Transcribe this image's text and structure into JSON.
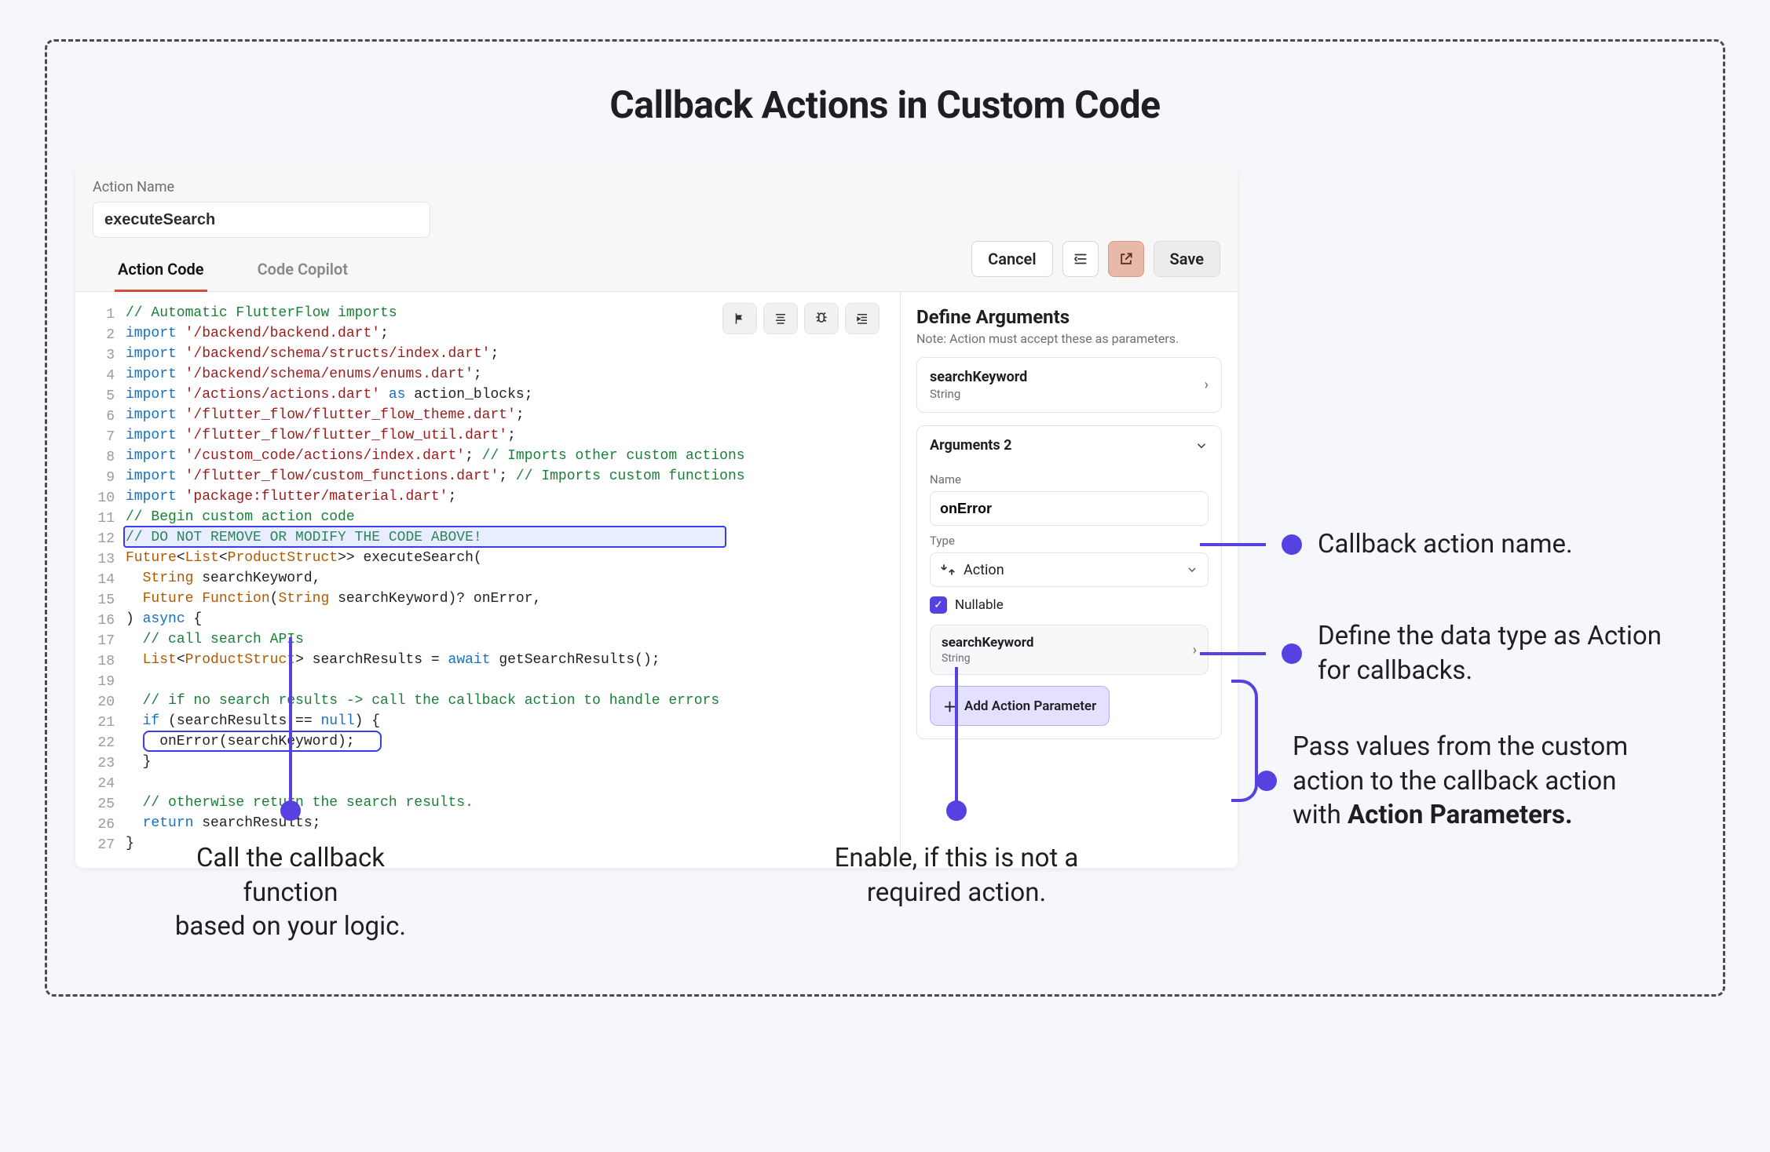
{
  "title": "Callback Actions in Custom Code",
  "toolbar": {
    "label": "Action Name",
    "action_name": "executeSearch",
    "cancel": "Cancel",
    "save": "Save"
  },
  "tabs": {
    "code": "Action Code",
    "copilot": "Code Copilot"
  },
  "code": {
    "lines": [
      {
        "n": 1,
        "seg": [
          [
            "com",
            "// Automatic FlutterFlow imports"
          ]
        ]
      },
      {
        "n": 2,
        "seg": [
          [
            "kw",
            "import "
          ],
          [
            "str",
            "'/backend/backend.dart'"
          ],
          [
            "",
            ";"
          ]
        ]
      },
      {
        "n": 3,
        "seg": [
          [
            "kw",
            "import "
          ],
          [
            "str",
            "'/backend/schema/structs/index.dart'"
          ],
          [
            "",
            ";"
          ]
        ]
      },
      {
        "n": 4,
        "seg": [
          [
            "kw",
            "import "
          ],
          [
            "str",
            "'/backend/schema/enums/enums.dart'"
          ],
          [
            "",
            ";"
          ]
        ]
      },
      {
        "n": 5,
        "seg": [
          [
            "kw",
            "import "
          ],
          [
            "str",
            "'/actions/actions.dart'"
          ],
          [
            "kw",
            " as"
          ],
          [
            "",
            " action_blocks;"
          ]
        ]
      },
      {
        "n": 6,
        "seg": [
          [
            "kw",
            "import "
          ],
          [
            "str",
            "'/flutter_flow/flutter_flow_theme.dart'"
          ],
          [
            "",
            ";"
          ]
        ]
      },
      {
        "n": 7,
        "seg": [
          [
            "kw",
            "import "
          ],
          [
            "str",
            "'/flutter_flow/flutter_flow_util.dart'"
          ],
          [
            "",
            ";"
          ]
        ]
      },
      {
        "n": 8,
        "seg": [
          [
            "kw",
            "import "
          ],
          [
            "str",
            "'/custom_code/actions/index.dart'"
          ],
          [
            "",
            ";"
          ],
          [
            "com",
            " // Imports other custom actions"
          ]
        ]
      },
      {
        "n": 9,
        "seg": [
          [
            "kw",
            "import "
          ],
          [
            "str",
            "'/flutter_flow/custom_functions.dart'"
          ],
          [
            "",
            ";"
          ],
          [
            "com",
            " // Imports custom functions"
          ]
        ]
      },
      {
        "n": 10,
        "seg": [
          [
            "kw",
            "import "
          ],
          [
            "str",
            "'package:flutter/material.dart'"
          ],
          [
            "",
            ";"
          ]
        ]
      },
      {
        "n": 11,
        "seg": [
          [
            "com",
            "// Begin custom action code"
          ]
        ]
      },
      {
        "n": 12,
        "seg": [
          [
            "com",
            "// DO NOT REMOVE OR MODIFY THE CODE ABOVE!"
          ]
        ]
      },
      {
        "n": 13,
        "seg": [
          [
            "ty",
            "Future"
          ],
          [
            "",
            "<"
          ],
          [
            "ty",
            "List"
          ],
          [
            "",
            "<"
          ],
          [
            "ty",
            "ProductStruct"
          ],
          [
            "",
            ">> executeSearch("
          ]
        ]
      },
      {
        "n": 14,
        "seg": [
          [
            "",
            "  "
          ],
          [
            "ty",
            "String"
          ],
          [
            "",
            " searchKeyword,"
          ]
        ]
      },
      {
        "n": 15,
        "seg": [
          [
            "",
            "  "
          ],
          [
            "ty",
            "Future Function"
          ],
          [
            "",
            "("
          ],
          [
            "ty",
            "String"
          ],
          [
            "",
            " searchKeyword)? onError,"
          ]
        ]
      },
      {
        "n": 16,
        "seg": [
          [
            "",
            ") "
          ],
          [
            "kw",
            "async"
          ],
          [
            "",
            " {"
          ]
        ]
      },
      {
        "n": 17,
        "seg": [
          [
            "",
            "  "
          ],
          [
            "com",
            "// call search APIs"
          ]
        ]
      },
      {
        "n": 18,
        "seg": [
          [
            "",
            "  "
          ],
          [
            "ty",
            "List"
          ],
          [
            "",
            "<"
          ],
          [
            "ty",
            "ProductStruct"
          ],
          [
            "",
            "> searchResults = "
          ],
          [
            "kw",
            "await"
          ],
          [
            "",
            " getSearchResults();"
          ]
        ]
      },
      {
        "n": 19,
        "seg": [
          [
            "",
            ""
          ]
        ]
      },
      {
        "n": 20,
        "seg": [
          [
            "",
            "  "
          ],
          [
            "com",
            "// if no search results -> call the callback action to handle errors"
          ]
        ]
      },
      {
        "n": 21,
        "seg": [
          [
            "",
            "  "
          ],
          [
            "kw",
            "if"
          ],
          [
            "",
            " (searchResults == "
          ],
          [
            "kw",
            "null"
          ],
          [
            "",
            ") {"
          ]
        ]
      },
      {
        "n": 22,
        "seg": [
          [
            "",
            "    onError(searchKeyword);"
          ]
        ]
      },
      {
        "n": 23,
        "seg": [
          [
            "",
            "  }"
          ]
        ]
      },
      {
        "n": 24,
        "seg": [
          [
            "",
            ""
          ]
        ]
      },
      {
        "n": 25,
        "seg": [
          [
            "",
            "  "
          ],
          [
            "com",
            "// otherwise return the search results."
          ]
        ]
      },
      {
        "n": 26,
        "seg": [
          [
            "",
            "  "
          ],
          [
            "kw",
            "return"
          ],
          [
            "",
            " searchResults;"
          ]
        ]
      },
      {
        "n": 27,
        "seg": [
          [
            "",
            "}"
          ]
        ]
      }
    ]
  },
  "side": {
    "heading": "Define Arguments",
    "note": "Note: Action must accept these as parameters.",
    "arg1": {
      "name": "searchKeyword",
      "type": "String"
    },
    "arg2": {
      "title": "Arguments 2",
      "name_label": "Name",
      "name_value": "onError",
      "type_label": "Type",
      "type_value": "Action",
      "nullable": "Nullable",
      "nested_name": "searchKeyword",
      "nested_type": "String",
      "add_param": "Add Action Parameter"
    }
  },
  "callouts": {
    "c1": "Callback action name.",
    "c2": "Define the data type as Action for callbacks.",
    "c3_prefix": "Pass values from the custom action to the callback action with ",
    "c3_bold": "Action Parameters.",
    "b1_l1": "Call the callback function",
    "b1_l2": "based on your logic.",
    "b2_l1": "Enable, if this is not a",
    "b2_l2": "required action."
  }
}
